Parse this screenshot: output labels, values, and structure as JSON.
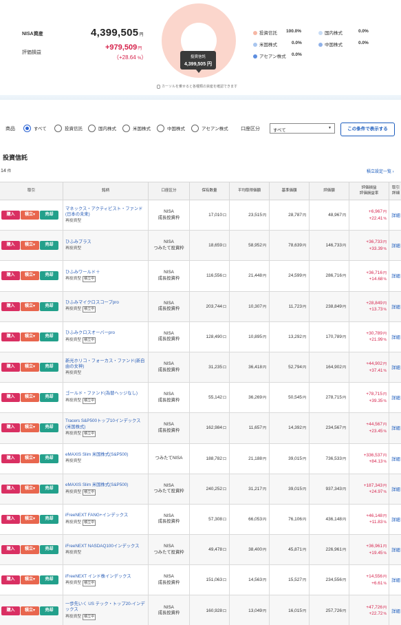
{
  "summary": {
    "nisa_label": "NISA資産",
    "nisa_total": "4,399,505",
    "unit_yen": "円",
    "pl_label": "評価損益",
    "pl_value": "+979,509",
    "pl_percent_open": "（",
    "pl_percent": "+28.64",
    "pl_percent_unit": "%",
    "pl_percent_close": "）",
    "tooltip_title": "投資信託",
    "tooltip_value": "4,399,505 円",
    "hint": "カーソルを乗せると各種類の資産を確認できます",
    "legend": [
      {
        "label": "投資信託",
        "pct": "100.0%",
        "color": "#f6b7a5"
      },
      {
        "label": "国内株式",
        "pct": "0.0%",
        "color": "#c8dcf5"
      },
      {
        "label": "米国株式",
        "pct": "0.0%",
        "color": "#a9c6ef"
      },
      {
        "label": "中国株式",
        "pct": "0.0%",
        "color": "#8fb1e8"
      },
      {
        "label": "アセアン株式",
        "pct": "0.0%",
        "color": "#5d8ee0"
      }
    ]
  },
  "filter": {
    "product_label": "商品",
    "options": [
      "すべて",
      "投資信託",
      "国内株式",
      "米国株式",
      "中国株式",
      "アセアン株式"
    ],
    "selected": "すべて",
    "account_label": "口座区分",
    "account_value": "すべて",
    "show_button": "この条件で表示する"
  },
  "section": {
    "title": "投資信託",
    "count": "14",
    "count_unit": "件",
    "settings_link": "積立設定一覧 ›"
  },
  "table": {
    "headers": {
      "trade": "取引",
      "name": "銘柄",
      "account": "口座区分",
      "qty": "保有数量",
      "avg": "平均取得価額",
      "base": "基準価額",
      "value": "評価額",
      "pl1": "評価損益",
      "pl2": "評価損益率",
      "detail1": "取引",
      "detail2": "詳細"
    },
    "buttons": {
      "buy": "購入",
      "tsumitate": "積立▾",
      "sell": "売却",
      "detail": "詳細"
    },
    "qty_unit": "口",
    "yen_unit": "円",
    "pct_unit": "%",
    "rows": [
      {
        "name": "マネックス・アクティビスト・ファンド(日本の未来)",
        "sub": "再投資型",
        "tag": "",
        "acct1": "NISA",
        "acct2": "成長投資枠",
        "qty": "17,010",
        "avg": "23,515",
        "base": "28,787",
        "value": "48,967",
        "pl": "+6,967",
        "plpct": "+22.41"
      },
      {
        "name": "ひふみプラス",
        "sub": "再投資型",
        "tag": "",
        "acct1": "NISA",
        "acct2": "つみたて投資枠",
        "qty": "18,659",
        "avg": "58,952",
        "base": "78,639",
        "value": "146,733",
        "pl": "+36,733",
        "plpct": "+33.39"
      },
      {
        "name": "ひふみワールド＋",
        "sub": "再投資型",
        "tag": "積立中",
        "acct1": "NISA",
        "acct2": "成長投資枠",
        "qty": "116,556",
        "avg": "21,448",
        "base": "24,599",
        "value": "286,716",
        "pl": "+36,716",
        "plpct": "+14.68"
      },
      {
        "name": "ひふみマイクロスコープpro",
        "sub": "再投資型",
        "tag": "積立中",
        "acct1": "NISA",
        "acct2": "成長投資枠",
        "qty": "203,744",
        "avg": "10,307",
        "base": "11,723",
        "value": "238,849",
        "pl": "+28,849",
        "plpct": "+13.73"
      },
      {
        "name": "ひふみクロスオーバーpro",
        "sub": "再投資型",
        "tag": "積立中",
        "acct1": "NISA",
        "acct2": "成長投資枠",
        "qty": "128,490",
        "avg": "10,895",
        "base": "13,292",
        "value": "170,789",
        "pl": "+30,789",
        "plpct": "+21.99"
      },
      {
        "name": "新光ホリコ・フォーカス・ファンド(新自由の女神)",
        "sub": "再投資型",
        "tag": "",
        "acct1": "NISA",
        "acct2": "成長投資枠",
        "qty": "31,235",
        "avg": "36,418",
        "base": "52,794",
        "value": "164,902",
        "pl": "+44,902",
        "plpct": "+37.41"
      },
      {
        "name": "ゴールド・ファンド(為替ヘッジなし)",
        "sub": "再投資型",
        "tag": "積立中",
        "acct1": "NISA",
        "acct2": "成長投資枠",
        "qty": "55,142",
        "avg": "36,269",
        "base": "50,545",
        "value": "278,715",
        "pl": "+78,715",
        "plpct": "+39.35"
      },
      {
        "name": "Tracers S&P500トップ10インデックス(米国株式)",
        "sub": "再投資型",
        "tag": "積立中",
        "acct1": "NISA",
        "acct2": "成長投資枠",
        "qty": "162,984",
        "avg": "11,657",
        "base": "14,392",
        "value": "234,567",
        "pl": "+44,567",
        "plpct": "+23.45"
      },
      {
        "name": "eMAXIS Slim 米国株式(S&P500)",
        "sub": "再投資型",
        "tag": "",
        "acct1": "つみたてNISA",
        "acct2": "",
        "qty": "188,782",
        "avg": "21,188",
        "base": "39,015",
        "value": "736,533",
        "pl": "+336,537",
        "plpct": "+84.13"
      },
      {
        "name": "eMAXIS Slim 米国株式(S&P500)",
        "sub": "再投資型",
        "tag": "積立中",
        "acct1": "NISA",
        "acct2": "つみたて投資枠",
        "qty": "240,252",
        "avg": "31,217",
        "base": "39,015",
        "value": "937,343",
        "pl": "+187,343",
        "plpct": "+24.97"
      },
      {
        "name": "iFreeNEXT FANG+インデックス",
        "sub": "再投資型",
        "tag": "積立中",
        "acct1": "NISA",
        "acct2": "成長投資枠",
        "qty": "57,308",
        "avg": "66,053",
        "base": "76,106",
        "value": "436,148",
        "pl": "+46,148",
        "plpct": "+11.83"
      },
      {
        "name": "iFreeNEXT NASDAQ100インデックス",
        "sub": "再投資型",
        "tag": "",
        "acct1": "NISA",
        "acct2": "つみたて投資枠",
        "qty": "49,478",
        "avg": "38,400",
        "base": "45,871",
        "value": "226,961",
        "pl": "+36,961",
        "plpct": "+19.45"
      },
      {
        "name": "iFreeNEXT インド株インデックス",
        "sub": "再投資型",
        "tag": "積立中",
        "acct1": "NISA",
        "acct2": "成長投資枠",
        "qty": "151,063",
        "avg": "14,563",
        "base": "15,527",
        "value": "234,556",
        "pl": "+14,556",
        "plpct": "+6.61"
      },
      {
        "name": "一歩先いく US テック・トップ20-インデックス",
        "sub": "再投資型",
        "tag": "積立中",
        "acct1": "NISA",
        "acct2": "成長投資枠",
        "qty": "160,928",
        "avg": "13,049",
        "base": "16,015",
        "value": "257,726",
        "pl": "+47,726",
        "plpct": "+22.72"
      }
    ]
  }
}
